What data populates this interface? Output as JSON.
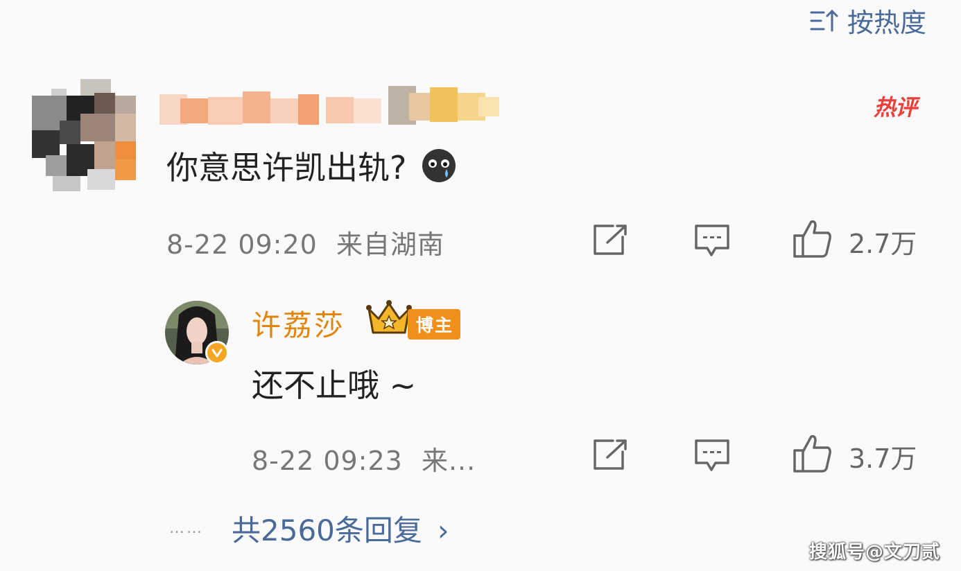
{
  "sort": {
    "label": "按热度"
  },
  "comment": {
    "hot_badge": "热评",
    "text": "你意思许凯出轨?",
    "emoji_icon": "sweat-crying-emoji-icon",
    "date": "8-22 09:20",
    "location": "来自湖南",
    "likes": "2.7万"
  },
  "reply": {
    "author": "许荔莎",
    "badge": "博主",
    "text": "还不止哦 ~",
    "date": "8-22 09:23",
    "location_truncated": "来...",
    "likes": "3.7万"
  },
  "more_replies": {
    "dots": "……",
    "label": "共2560条回复"
  },
  "watermark": "搜狐号@文刀贰",
  "colors": {
    "accent_blue": "#4a6a9a",
    "hot_red": "#e8403a",
    "blogger_orange": "#e0860f",
    "badge_orange": "#f0901a"
  }
}
